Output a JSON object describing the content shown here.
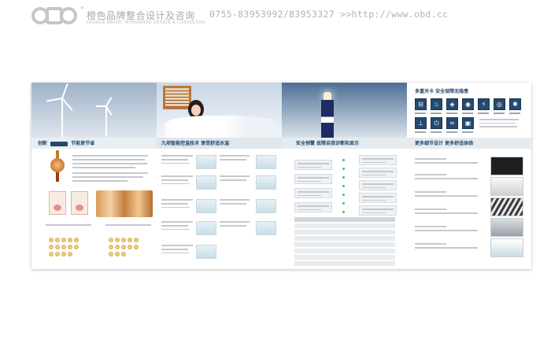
{
  "header": {
    "brand_cn": "橙色品牌整合设计及咨询",
    "brand_en": "ORANGE BRAND INTEGRATED DESIGN & CONSULTING",
    "logo_mark": "®",
    "contact": "0755-83953992/83953327 >>http://www.obd.cc"
  },
  "brochure": {
    "panel1": {
      "band_prefix": "创新",
      "band_title": "节能更节省"
    },
    "panel2": {
      "band_title": "九项智能控温技术 享受舒适水温"
    },
    "panel3": {
      "band_title": "安全预警 故障自我诊断和显示"
    },
    "panel4": {
      "title": "多重关卡 安全保障无隐患",
      "band_title": "更多细节设计 更多舒适体验"
    }
  },
  "colors": {
    "navy": "#234a6e",
    "header_gray": "#a9a9a9",
    "green_dot": "#56b66b"
  }
}
